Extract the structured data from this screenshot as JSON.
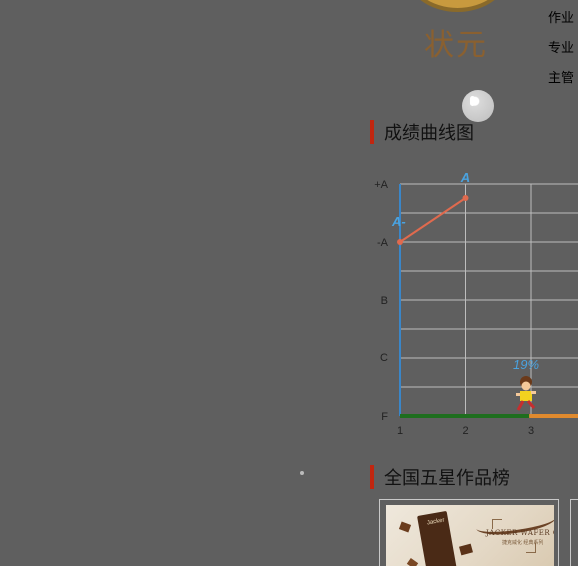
{
  "badge": {
    "text": "状元"
  },
  "side_links": [
    "作业",
    "专业",
    "主管"
  ],
  "sections": {
    "chart_title": "成绩曲线图",
    "works_title": "全国五星作品榜"
  },
  "chart_data": {
    "type": "line",
    "y_tick_labels": [
      "+A",
      "-A",
      "B",
      "C",
      "F"
    ],
    "x_tick_labels": [
      "1",
      "2",
      "3"
    ],
    "series": [
      {
        "points": [
          {
            "x": 1,
            "y": "-A"
          },
          {
            "x": 2,
            "y": "A"
          }
        ]
      }
    ],
    "point_labels": [
      "A-",
      "A"
    ],
    "progress": {
      "percent": 19,
      "label": "19%"
    },
    "grid": true,
    "colors": {
      "line": "#e06a4e",
      "axis": "#3a86c8",
      "grid": "#bdbdbd",
      "progress_done": "#1e6e1e",
      "progress_rest": "#e08a2e",
      "label": "#4aa3e0"
    }
  },
  "works": {
    "card1": {
      "title": "JACKER WAFER CUBE",
      "subtitle": "捷克威化 经典系列",
      "box_label": "Jacker"
    }
  }
}
